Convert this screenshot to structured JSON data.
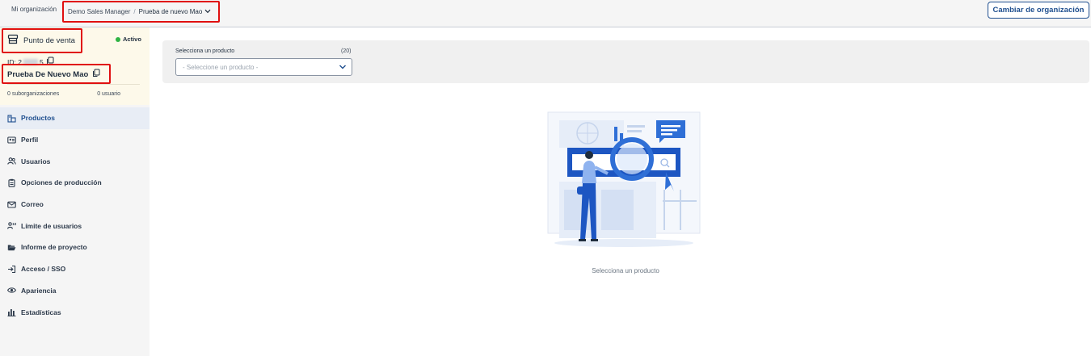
{
  "topbar": {
    "org_label": "Mi organización",
    "breadcrumb": {
      "parent": "Demo Sales Manager",
      "separator": "/",
      "current": "Prueba de nuevo Mao"
    },
    "switch_button": "Cambiar de organización"
  },
  "org_card": {
    "type_label": "Punto de venta",
    "status": "Activo",
    "id_prefix": "ID: 2",
    "id_suffix": "5",
    "name": "Prueba De Nuevo Mao",
    "suborganizations": "0 suborganizaciones",
    "users": "0 usuario"
  },
  "nav": {
    "items": [
      {
        "label": "Productos",
        "icon": "products-icon",
        "active": true
      },
      {
        "label": "Perfil",
        "icon": "id-card-icon"
      },
      {
        "label": "Usuarios",
        "icon": "users-icon"
      },
      {
        "label": "Opciones de producción",
        "icon": "clipboard-icon"
      },
      {
        "label": "Correo",
        "icon": "mail-icon"
      },
      {
        "label": "Límite de usuarios",
        "icon": "user-limit-icon"
      },
      {
        "label": "Informe de proyecto",
        "icon": "folder-open-icon"
      },
      {
        "label": "Acceso / SSO",
        "icon": "sign-in-icon"
      },
      {
        "label": "Apariencia",
        "icon": "eye-icon"
      },
      {
        "label": "Estadísticas",
        "icon": "bar-chart-icon"
      }
    ]
  },
  "main": {
    "product_select": {
      "label": "Selecciona un producto",
      "count": "(20)",
      "placeholder": "- Seleccione un producto -"
    },
    "empty_state": "Selecciona un producto"
  },
  "colors": {
    "accent": "#1f4f8f",
    "active_dot": "#2fb344",
    "highlight": "#e01010",
    "illustration_blue": "#2f6fd6"
  }
}
